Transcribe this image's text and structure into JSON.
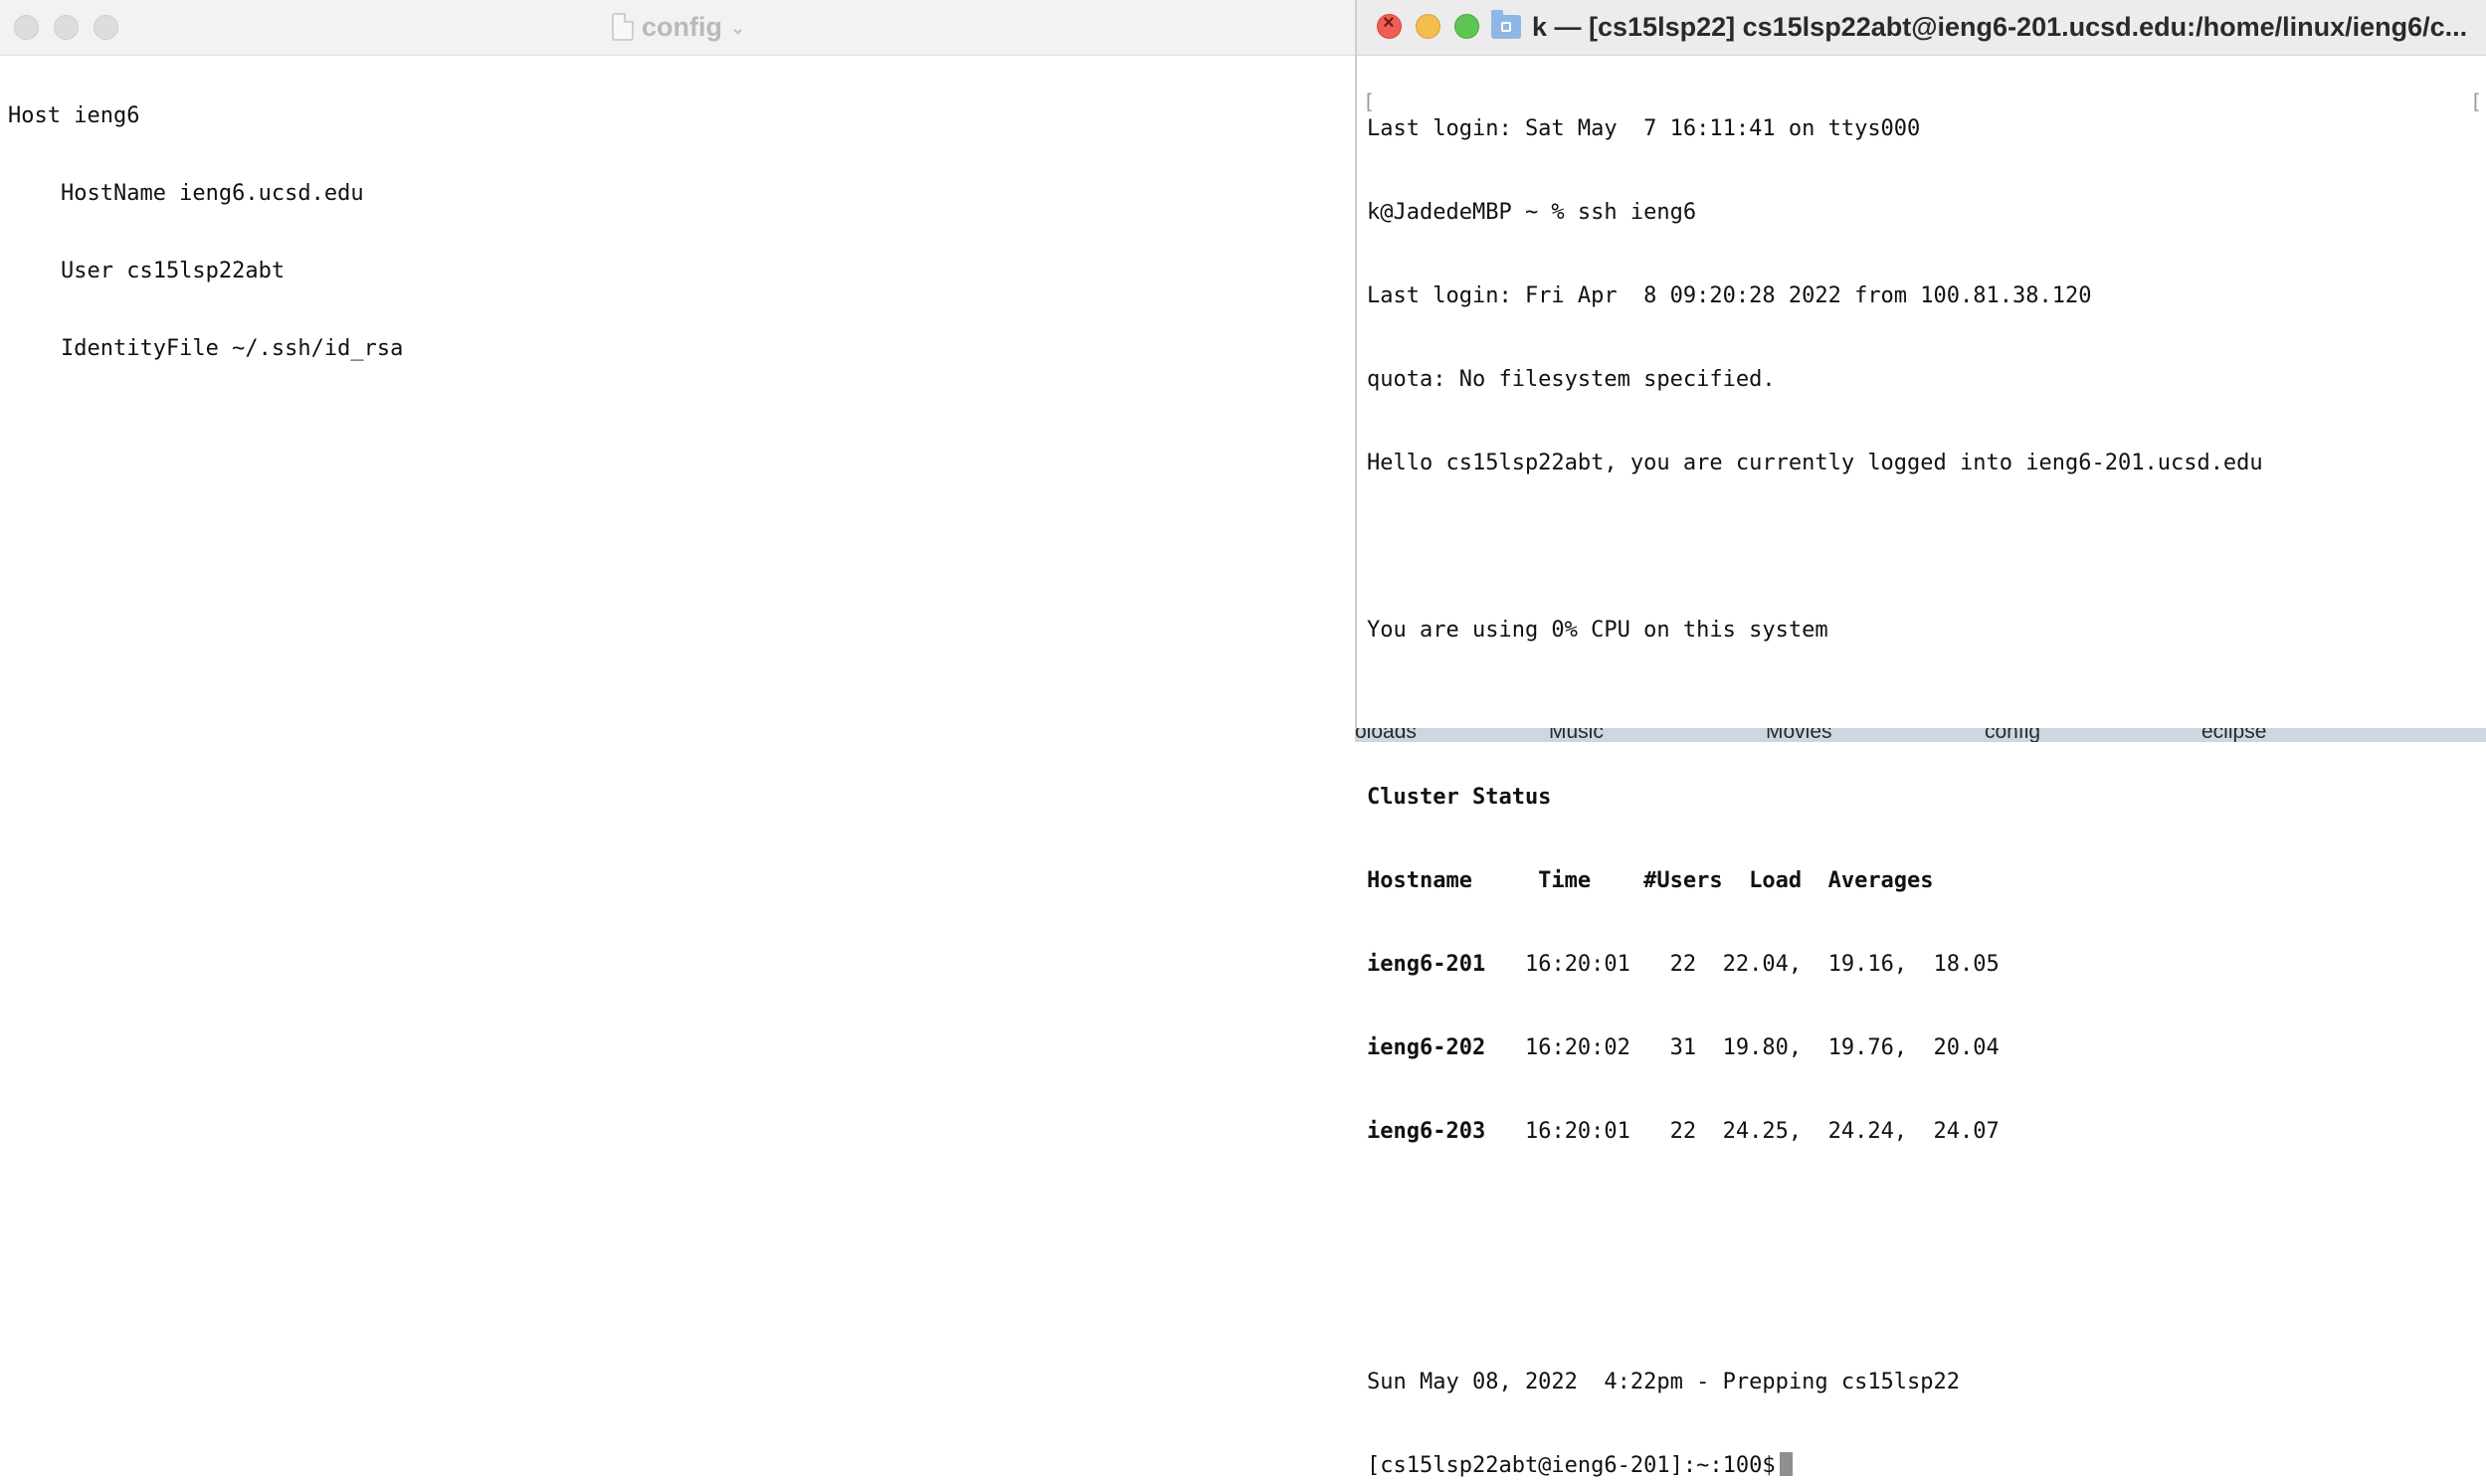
{
  "editor": {
    "title": "config",
    "lines": [
      "Host ieng6",
      "    HostName ieng6.ucsd.edu",
      "    User cs15lsp22abt",
      "    IdentityFile ~/.ssh/id_rsa"
    ]
  },
  "terminal": {
    "title": "k — [cs15lsp22]  cs15lsp22abt@ieng6-201.ucsd.edu:/home/linux/ieng6/c...",
    "lines": {
      "l1": "Last login: Sat May  7 16:11:41 on ttys000",
      "l2": "k@JadedeMBP ~ % ssh ieng6",
      "l3": "Last login: Fri Apr  8 09:20:28 2022 from 100.81.38.120",
      "l4": "quota: No filesystem specified.",
      "l5": "Hello cs15lsp22abt, you are currently logged into ieng6-201.ucsd.edu",
      "l6": "You are using 0% CPU on this system",
      "cluster_title": "Cluster Status",
      "header": "Hostname     Time    #Users  Load  Averages",
      "rows": [
        {
          "host": "ieng6-201",
          "rest": "   16:20:01   22  22.04,  19.16,  18.05"
        },
        {
          "host": "ieng6-202",
          "rest": "   16:20:02   31  19.80,  19.76,  20.04"
        },
        {
          "host": "ieng6-203",
          "rest": "   16:20:01   22  24.25,  24.24,  24.07"
        }
      ],
      "l_date": "Sun May 08, 2022  4:22pm - Prepping cs15lsp22",
      "prompt": "[cs15lsp22abt@ieng6-201]:~:100$"
    }
  },
  "desktop": {
    "items": [
      "oloads",
      "Music",
      "Movies",
      "config",
      "eclipse"
    ]
  },
  "colors": {
    "close": "#ed5f56",
    "minimize": "#f4be4f",
    "zoom": "#5fc454",
    "folder": "#8fb7e6"
  }
}
